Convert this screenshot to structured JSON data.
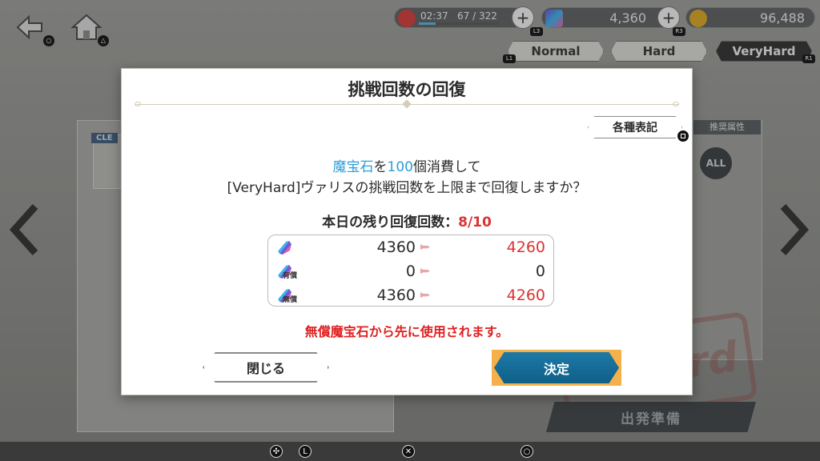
{
  "background": {
    "clear_tag": "CLE",
    "stage_name": "ヴァリス",
    "recommended_attr_label": "推奨属性",
    "all_badge": "ALL",
    "stamp_text": "Hard",
    "depart_button": "出発準備"
  },
  "top_bar": {
    "stamina_time": "02:37",
    "stamina_value": "67 / 322",
    "stamina_fill": 0.21,
    "gem_amount": "4,360",
    "coin_amount": "96,488",
    "button_tags": [
      "L3",
      "R3",
      "L1",
      "R1"
    ]
  },
  "difficulty_tabs": [
    {
      "label": "Normal",
      "active": false
    },
    {
      "label": "Hard",
      "active": false
    },
    {
      "label": "VeryHard",
      "active": true
    }
  ],
  "modal": {
    "title": "挑戦回数の回復",
    "notation_button": "各種表記",
    "message_line1": {
      "gem": "魔宝石",
      "part1": "を",
      "amount": "100",
      "part2": "個消費して"
    },
    "message_line2": "[VeryHard]ヴァリスの挑戦回数を上限まで回復しますか？",
    "remaining_label": "本日の残り回復回数：",
    "remaining_count": "8/10",
    "gem_rows": [
      {
        "label": "",
        "before": "4360",
        "after": "4260"
      },
      {
        "label": "有償",
        "before": "0",
        "after": "0"
      },
      {
        "label": "無償",
        "before": "4360",
        "after": "4260"
      }
    ],
    "arrow_glyphs": "▶▸▸",
    "warning": "無償魔宝石から先に使用されます。",
    "close_button": "閉じる",
    "confirm_button": "決定"
  },
  "colors": {
    "accent_blue": "#2a9fd8",
    "warning_red": "#e02020",
    "confirm_bg": "#1d7aa6",
    "confirm_border": "#f5b04a"
  }
}
